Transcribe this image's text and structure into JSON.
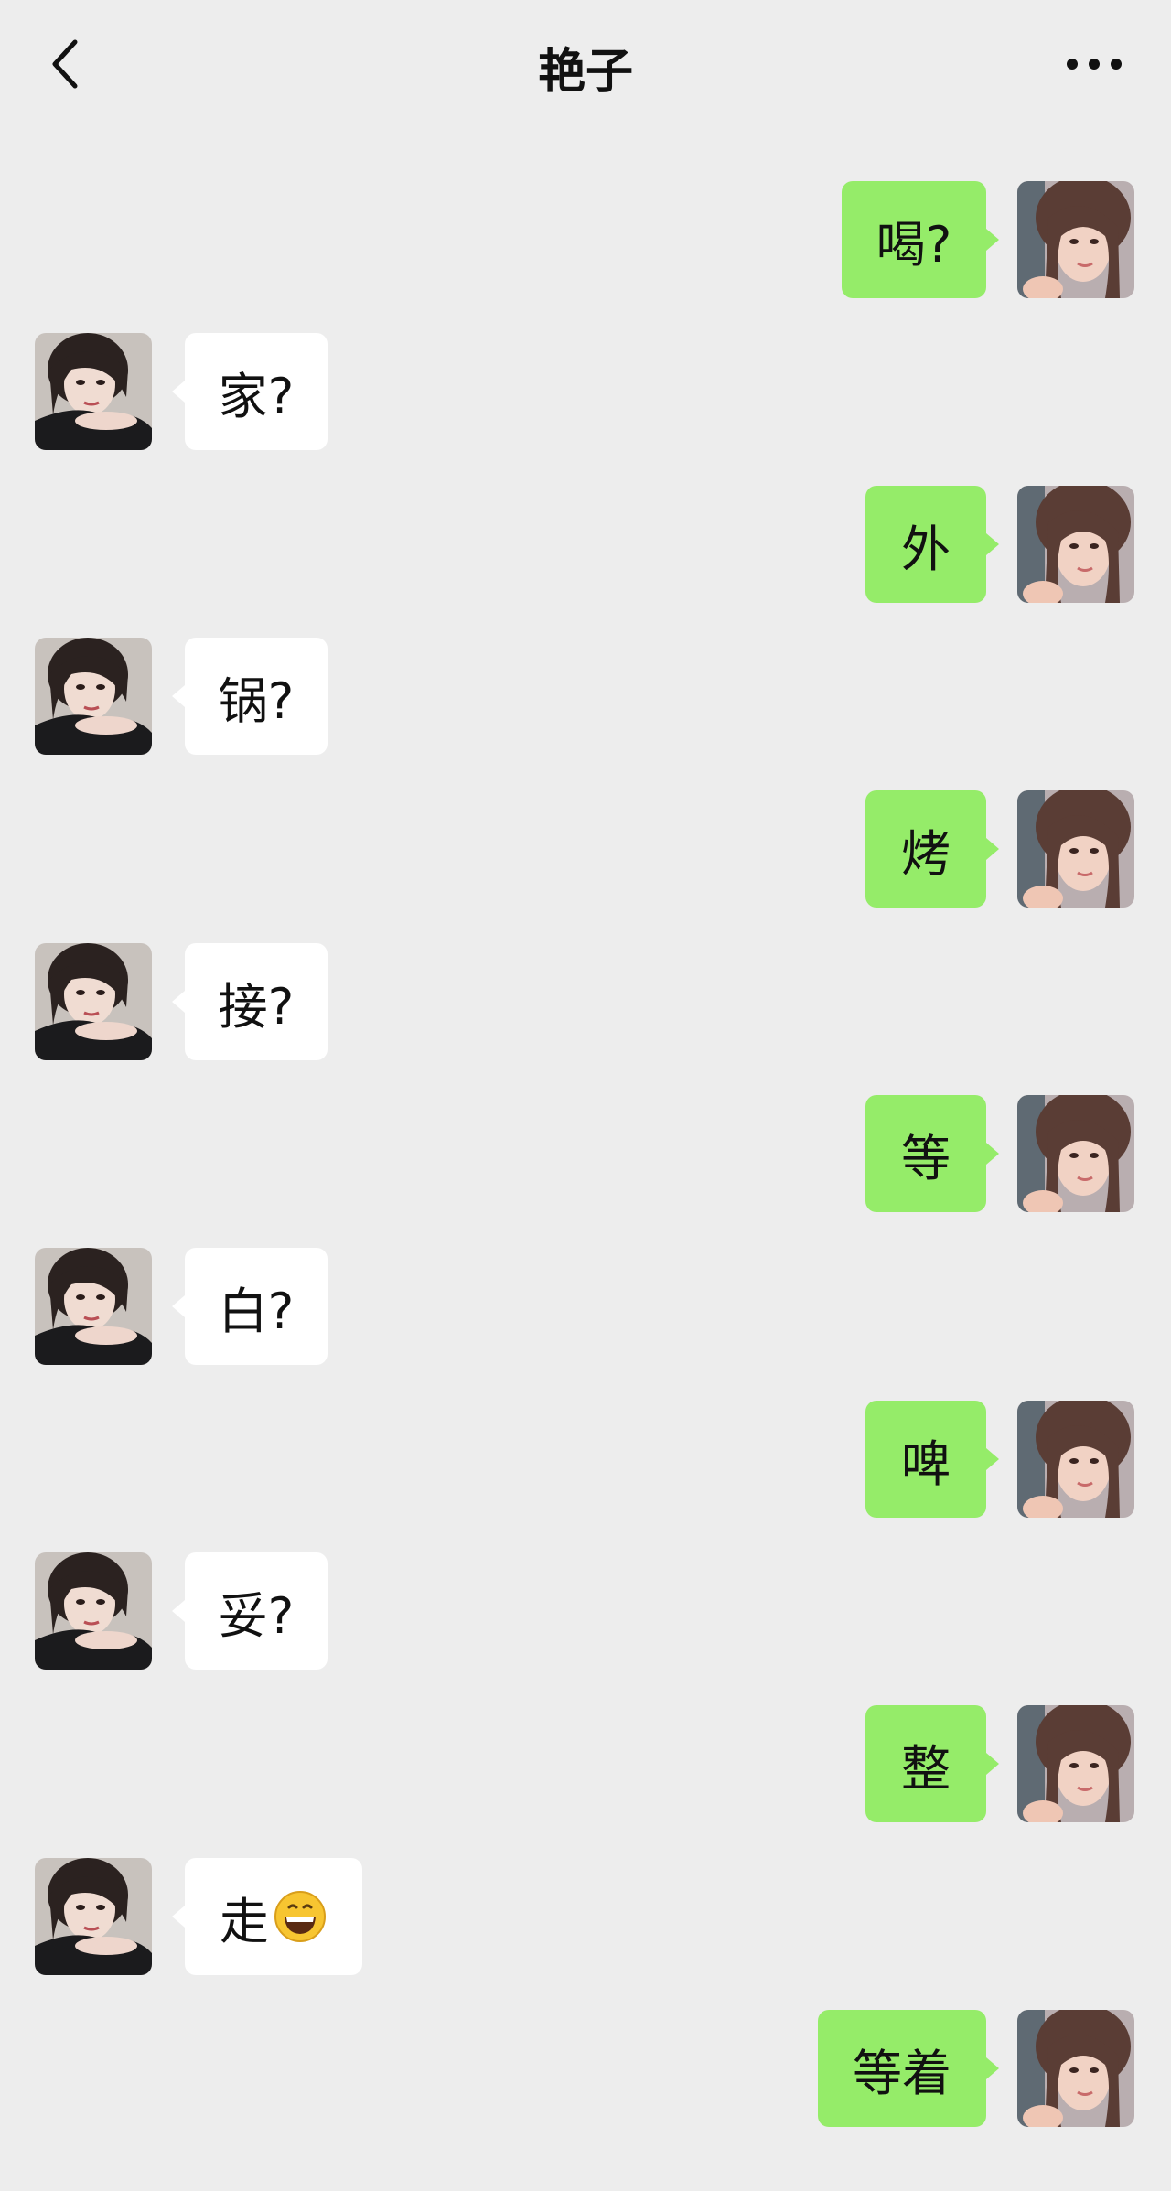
{
  "header": {
    "title": "艳子",
    "back_icon": "chevron-left-icon",
    "more_icon": "more-dots-icon"
  },
  "colors": {
    "background": "#ededed",
    "my_bubble": "#95ec69",
    "their_bubble": "#ffffff"
  },
  "messages": [
    {
      "sender": "me",
      "text": "喝?"
    },
    {
      "sender": "them",
      "text": "家?"
    },
    {
      "sender": "me",
      "text": "外"
    },
    {
      "sender": "them",
      "text": "锅?"
    },
    {
      "sender": "me",
      "text": "烤"
    },
    {
      "sender": "them",
      "text": "接?"
    },
    {
      "sender": "me",
      "text": "等"
    },
    {
      "sender": "them",
      "text": "白?"
    },
    {
      "sender": "me",
      "text": "啤"
    },
    {
      "sender": "them",
      "text": "妥?"
    },
    {
      "sender": "me",
      "text": "整"
    },
    {
      "sender": "them",
      "text": "走",
      "emoji": "grinning-face-emoji"
    },
    {
      "sender": "me",
      "text": "等着"
    }
  ]
}
